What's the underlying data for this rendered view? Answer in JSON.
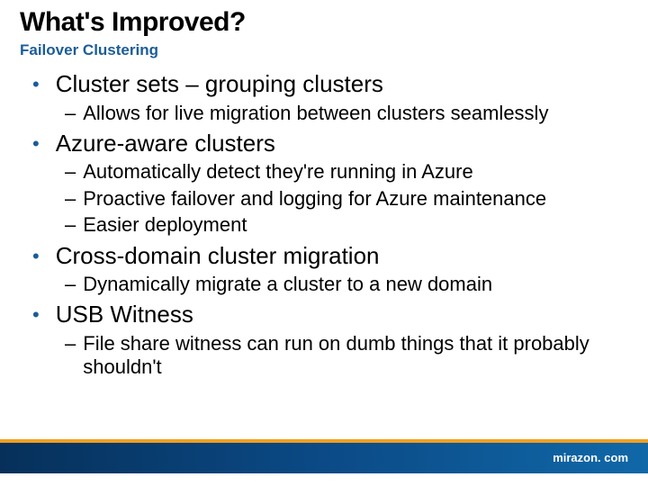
{
  "title": "What's Improved?",
  "subtitle": "Failover Clustering",
  "items": [
    {
      "label": "Cluster sets – grouping clusters",
      "sub": [
        "Allows for live migration between clusters seamlessly"
      ]
    },
    {
      "label": "Azure-aware clusters",
      "sub": [
        "Automatically detect they're running in Azure",
        "Proactive failover and logging for Azure maintenance",
        "Easier deployment"
      ]
    },
    {
      "label": "Cross-domain cluster migration",
      "sub": [
        "Dynamically migrate a cluster to a new domain"
      ]
    },
    {
      "label": "USB Witness",
      "sub": [
        "File share witness can run on dumb things that it probably shouldn't"
      ]
    }
  ],
  "footer": {
    "brand": "mirazon. com"
  }
}
